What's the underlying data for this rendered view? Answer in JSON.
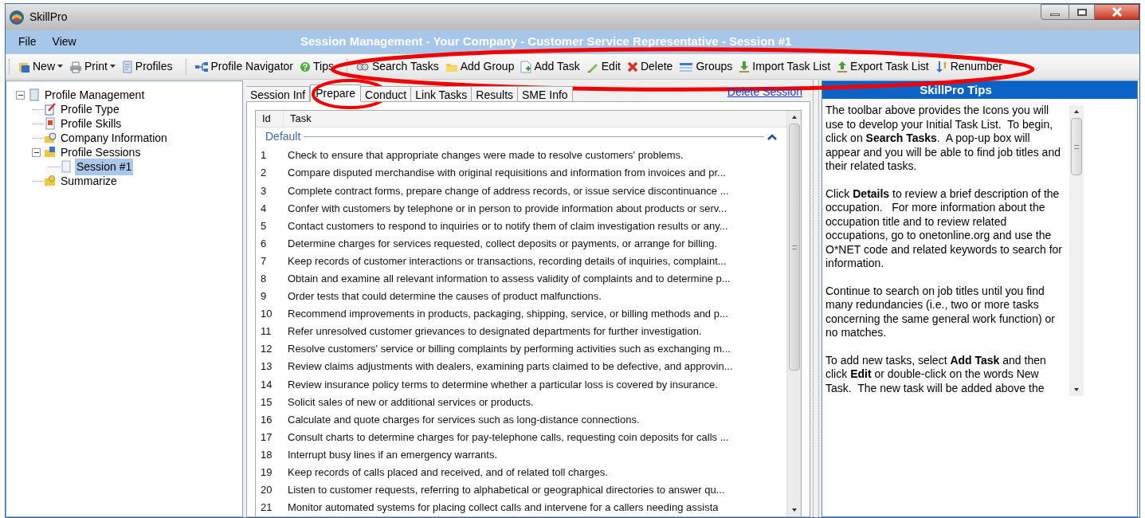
{
  "window": {
    "title": "SkillPro"
  },
  "menu": [
    {
      "label": "File"
    },
    {
      "label": "View"
    }
  ],
  "header_title": "Session Management - Your Company - Customer Service Representative - Session #1",
  "toolbar": {
    "groups": [
      {
        "items": [
          {
            "label": "New",
            "dropdown": true
          },
          {
            "label": "Print",
            "dropdown": true
          },
          {
            "label": "Profiles"
          }
        ]
      },
      {
        "items": [
          {
            "label": "Profile Navigator"
          },
          {
            "label": "Tips"
          }
        ]
      },
      {
        "circled": true,
        "items": [
          {
            "label": "Search Tasks"
          },
          {
            "label": "Add Group"
          },
          {
            "label": "Add Task"
          },
          {
            "label": "Edit"
          },
          {
            "label": "Delete"
          },
          {
            "label": "Groups"
          },
          {
            "label": "Import Task List"
          },
          {
            "label": "Export Task List"
          },
          {
            "label": "Renumber"
          }
        ]
      }
    ]
  },
  "tree": [
    {
      "label": "Profile Management",
      "expanded": true,
      "selected": false,
      "children": [
        {
          "label": "Profile Type",
          "selected": false
        },
        {
          "label": "Profile Skills",
          "selected": false
        },
        {
          "label": "Company Information",
          "selected": false
        },
        {
          "label": "Profile Sessions",
          "expanded": true,
          "selected": false,
          "children": [
            {
              "label": "Session #1",
              "selected": true
            }
          ]
        },
        {
          "label": "Summarize",
          "selected": false
        }
      ]
    }
  ],
  "tabs": [
    {
      "label": "Session Inf",
      "selected": false
    },
    {
      "label": "Prepare",
      "selected": true,
      "circled": true
    },
    {
      "label": "Conduct",
      "selected": false
    },
    {
      "label": "Link Tasks",
      "selected": false
    },
    {
      "label": "Results",
      "selected": false
    },
    {
      "label": "SME Info",
      "selected": false
    }
  ],
  "delete_link": "Delete Session",
  "table": {
    "columns": [
      "Id",
      "Task"
    ],
    "group": {
      "label": "Default",
      "expanded": true
    },
    "rows": [
      {
        "id": "1",
        "task": "Check to ensure that appropriate changes were made to resolve customers' problems."
      },
      {
        "id": "2",
        "task": "Compare disputed merchandise with original requisitions and information from invoices and pr..."
      },
      {
        "id": "3",
        "task": "Complete contract forms, prepare change of address records, or issue service discontinuance ..."
      },
      {
        "id": "4",
        "task": "Confer with customers by telephone or in person to provide information about products or serv..."
      },
      {
        "id": "5",
        "task": "Contact customers to respond to inquiries or to notify them of claim investigation results or any..."
      },
      {
        "id": "6",
        "task": "Determine charges for services requested, collect deposits or payments, or arrange for billing."
      },
      {
        "id": "7",
        "task": "Keep records of customer interactions or transactions, recording details of inquiries, complaint..."
      },
      {
        "id": "8",
        "task": "Obtain and examine all relevant information to assess validity of complaints and to determine p..."
      },
      {
        "id": "9",
        "task": "Order tests that could determine the causes of product malfunctions."
      },
      {
        "id": "10",
        "task": "Recommend improvements in products, packaging, shipping, service, or billing methods and p..."
      },
      {
        "id": "11",
        "task": "Refer unresolved customer grievances to designated departments for further investigation."
      },
      {
        "id": "12",
        "task": "Resolve customers' service or billing complaints by performing activities such as exchanging m..."
      },
      {
        "id": "13",
        "task": "Review claims adjustments with dealers, examining parts claimed to be defective, and approvin..."
      },
      {
        "id": "14",
        "task": "Review insurance policy terms to determine whether a particular loss is covered by insurance."
      },
      {
        "id": "15",
        "task": "Solicit sales of new or additional services or products."
      },
      {
        "id": "16",
        "task": "Calculate and quote charges for services such as long-distance connections."
      },
      {
        "id": "17",
        "task": "Consult charts to determine charges for pay-telephone calls, requesting coin deposits for calls ..."
      },
      {
        "id": "18",
        "task": "Interrupt busy lines if an emergency warrants."
      },
      {
        "id": "19",
        "task": "Keep records of calls placed and received, and of related toll charges."
      },
      {
        "id": "20",
        "task": "Listen to customer requests, referring to alphabetical or geographical directories to answer qu..."
      },
      {
        "id": "21",
        "task": "Monitor automated systems for placing collect calls and intervene for a callers needing assista"
      }
    ]
  },
  "tips": {
    "title": "SkillPro Tips",
    "paragraphs": [
      "The toolbar above provides the Icons you will use to develop your Initial Task List.  To begin, click on **Search Tasks**.  A pop-up box will appear and you will be able to find job titles and their related tasks.",
      "Click **Details** to review a brief description of the occupation.   For more information about the occupation title and to review related occupations, go to onetonline.org and use the O*NET code and related keywords to search for information.",
      "Continue to search on job titles until you find many redundancies (i.e., two or more tasks concerning the same general work function) or no matches.",
      "To add new tasks, select **Add Task** and then click **Edit** or double-click on the words New Task.  The new task will be added above the"
    ]
  }
}
